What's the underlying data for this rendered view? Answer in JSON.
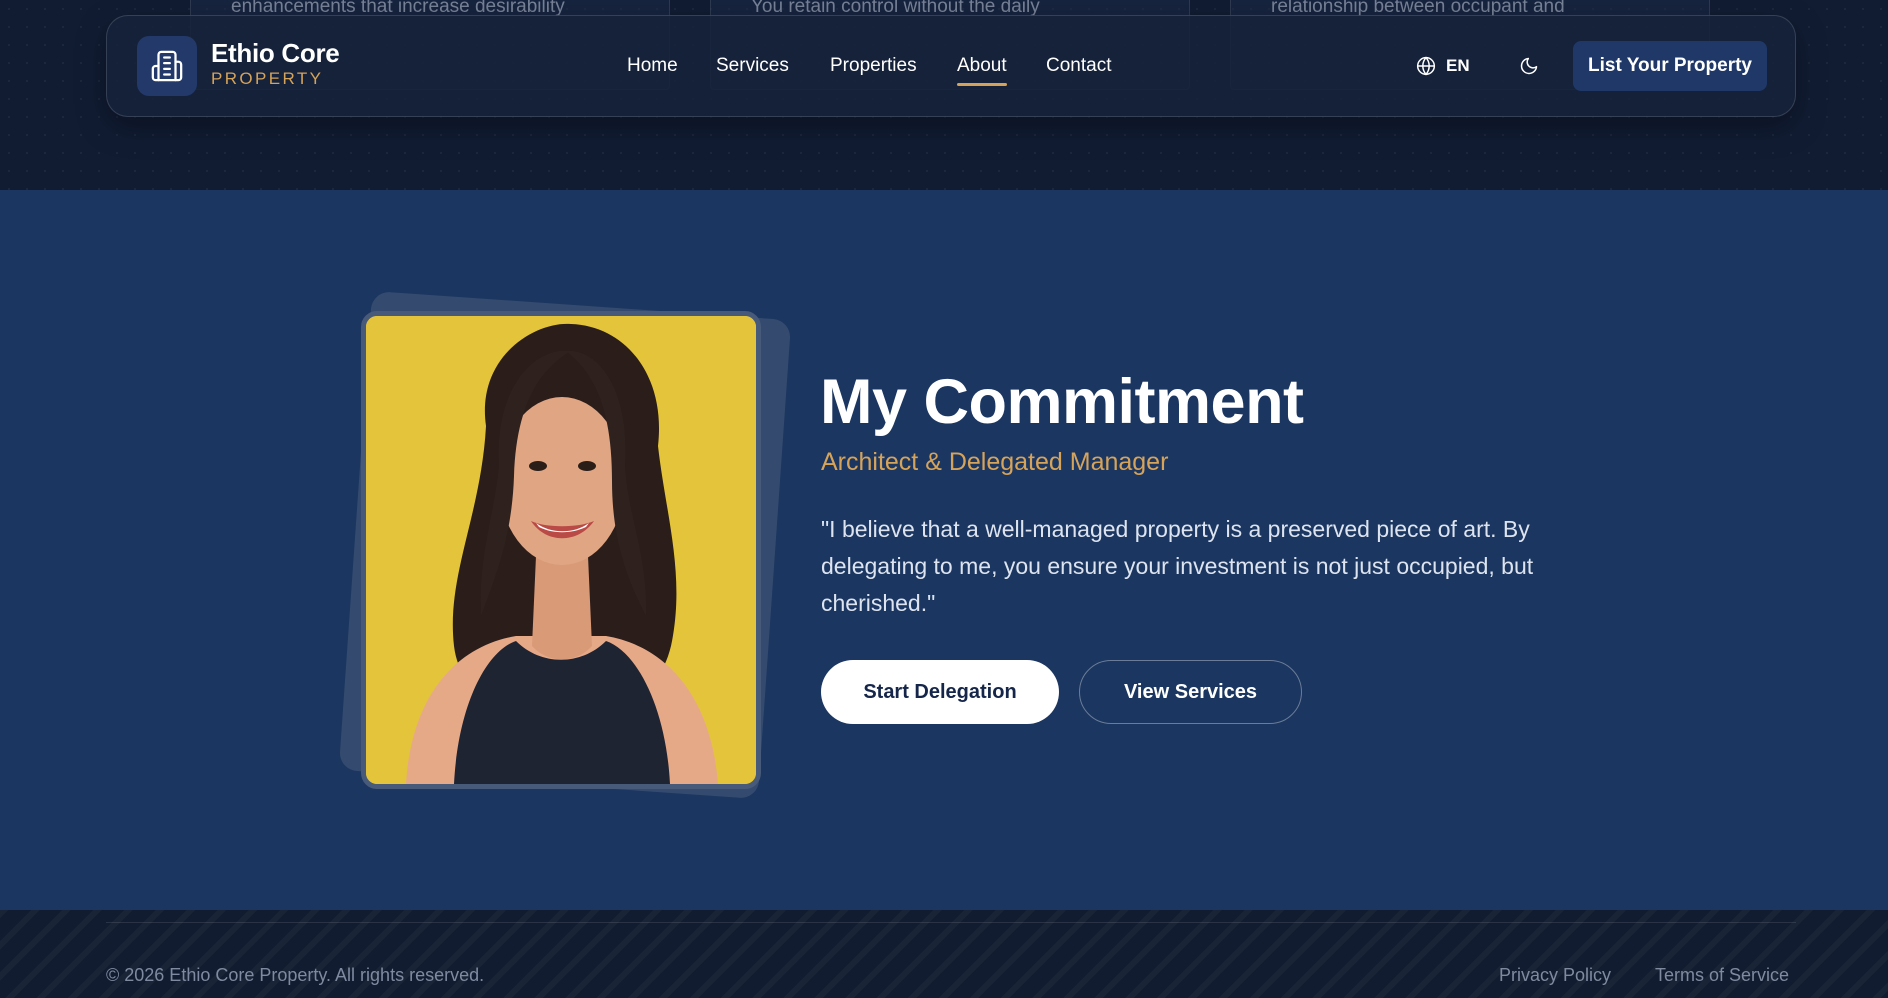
{
  "top_cards": [
    {
      "text": "enhancements that increase desirability"
    },
    {
      "text": "You retain control without the daily"
    },
    {
      "text": "relationship between occupant and"
    }
  ],
  "brand": {
    "name": "Ethio Core",
    "tagline": "PROPERTY",
    "logo_icon": "building-icon"
  },
  "nav": {
    "items": [
      {
        "label": "Home"
      },
      {
        "label": "Services"
      },
      {
        "label": "Properties"
      },
      {
        "label": "About",
        "active": true
      },
      {
        "label": "Contact"
      }
    ],
    "language": "EN",
    "language_icon": "globe-icon",
    "theme_icon": "moon-icon",
    "cta_label": "List Your Property"
  },
  "commitment": {
    "title": "My Commitment",
    "subtitle": "Architect & Delegated Manager",
    "quote": "\"I believe that a well-managed property is a preserved piece of art. By delegating to me, you ensure your investment is not just occupied, but cherished.\"",
    "primary_button": "Start Delegation",
    "secondary_button": "View Services",
    "photo": "portrait-photo"
  },
  "footer": {
    "copyright": "© 2026 Ethio Core Property. All rights reserved.",
    "links": [
      {
        "label": "Privacy Policy"
      },
      {
        "label": "Terms of Service"
      }
    ]
  },
  "colors": {
    "accent_gold": "#d6a35a",
    "section_blue": "#1b3660",
    "dark_bg": "#111c33",
    "cta_blue": "#1f3868"
  }
}
